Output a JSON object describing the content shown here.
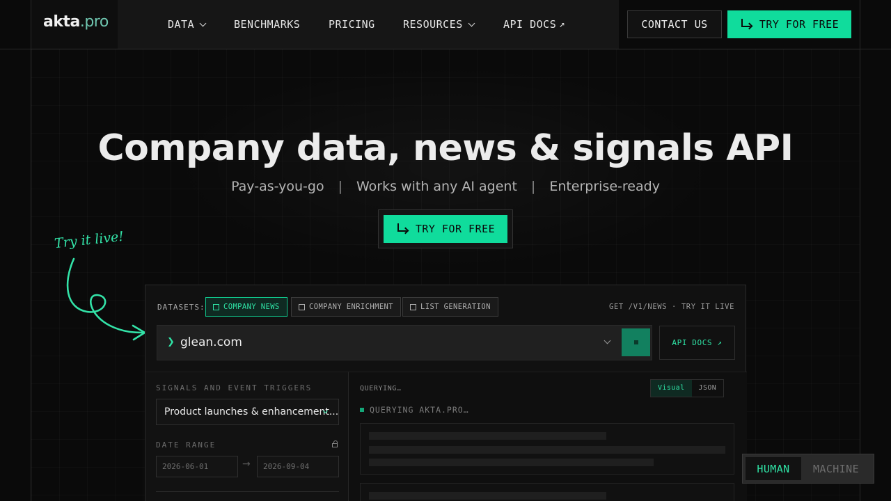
{
  "brand": {
    "name": "akta",
    "tld": ".pro",
    "accent": "#10dc9c"
  },
  "nav": {
    "items": [
      {
        "label": "DATA",
        "has_dropdown": true
      },
      {
        "label": "BENCHMARKS",
        "has_dropdown": false
      },
      {
        "label": "PRICING",
        "has_dropdown": false
      },
      {
        "label": "RESOURCES",
        "has_dropdown": true
      },
      {
        "label": "API DOCS",
        "external": true,
        "ext_icon": "↗"
      }
    ],
    "contact_label": "CONTACT US",
    "try_label": "TRY FOR FREE"
  },
  "hero": {
    "title": "Company data, news & signals API",
    "sub": [
      "Pay-as-you-go",
      "Works with any AI agent",
      "Enterprise-ready"
    ],
    "separator": "|",
    "cta_label": "TRY FOR FREE",
    "annotation": "Try it live!"
  },
  "demo": {
    "datasets_label": "DATASETS:",
    "chips": [
      {
        "label": "COMPANY NEWS",
        "active": true,
        "icon": "news-icon"
      },
      {
        "label": "COMPANY ENRICHMENT",
        "active": false,
        "icon": "building-icon"
      },
      {
        "label": "LIST GENERATION",
        "active": false,
        "icon": "list-icon"
      }
    ],
    "meta": "GET /V1/NEWS · TRY IT LIVE",
    "search": {
      "caret": "❯",
      "value": "glean.com"
    },
    "api_docs_label": "API DOCS ↗",
    "signals_label": "SIGNALS AND EVENT TRIGGERS",
    "signals_value": "Product launches & enhancement...",
    "date_range_label": "DATE RANGE",
    "date_from": "2026-06-01",
    "date_to": "2026-09-04",
    "date_arrow": "→",
    "querying_label": "QUERYING…",
    "view_visual": "Visual",
    "view_json": "JSON",
    "status": "QUERYING AKTA.PRO…"
  },
  "mode": {
    "human": "HUMAN",
    "machine": "MACHINE",
    "active": "HUMAN"
  }
}
